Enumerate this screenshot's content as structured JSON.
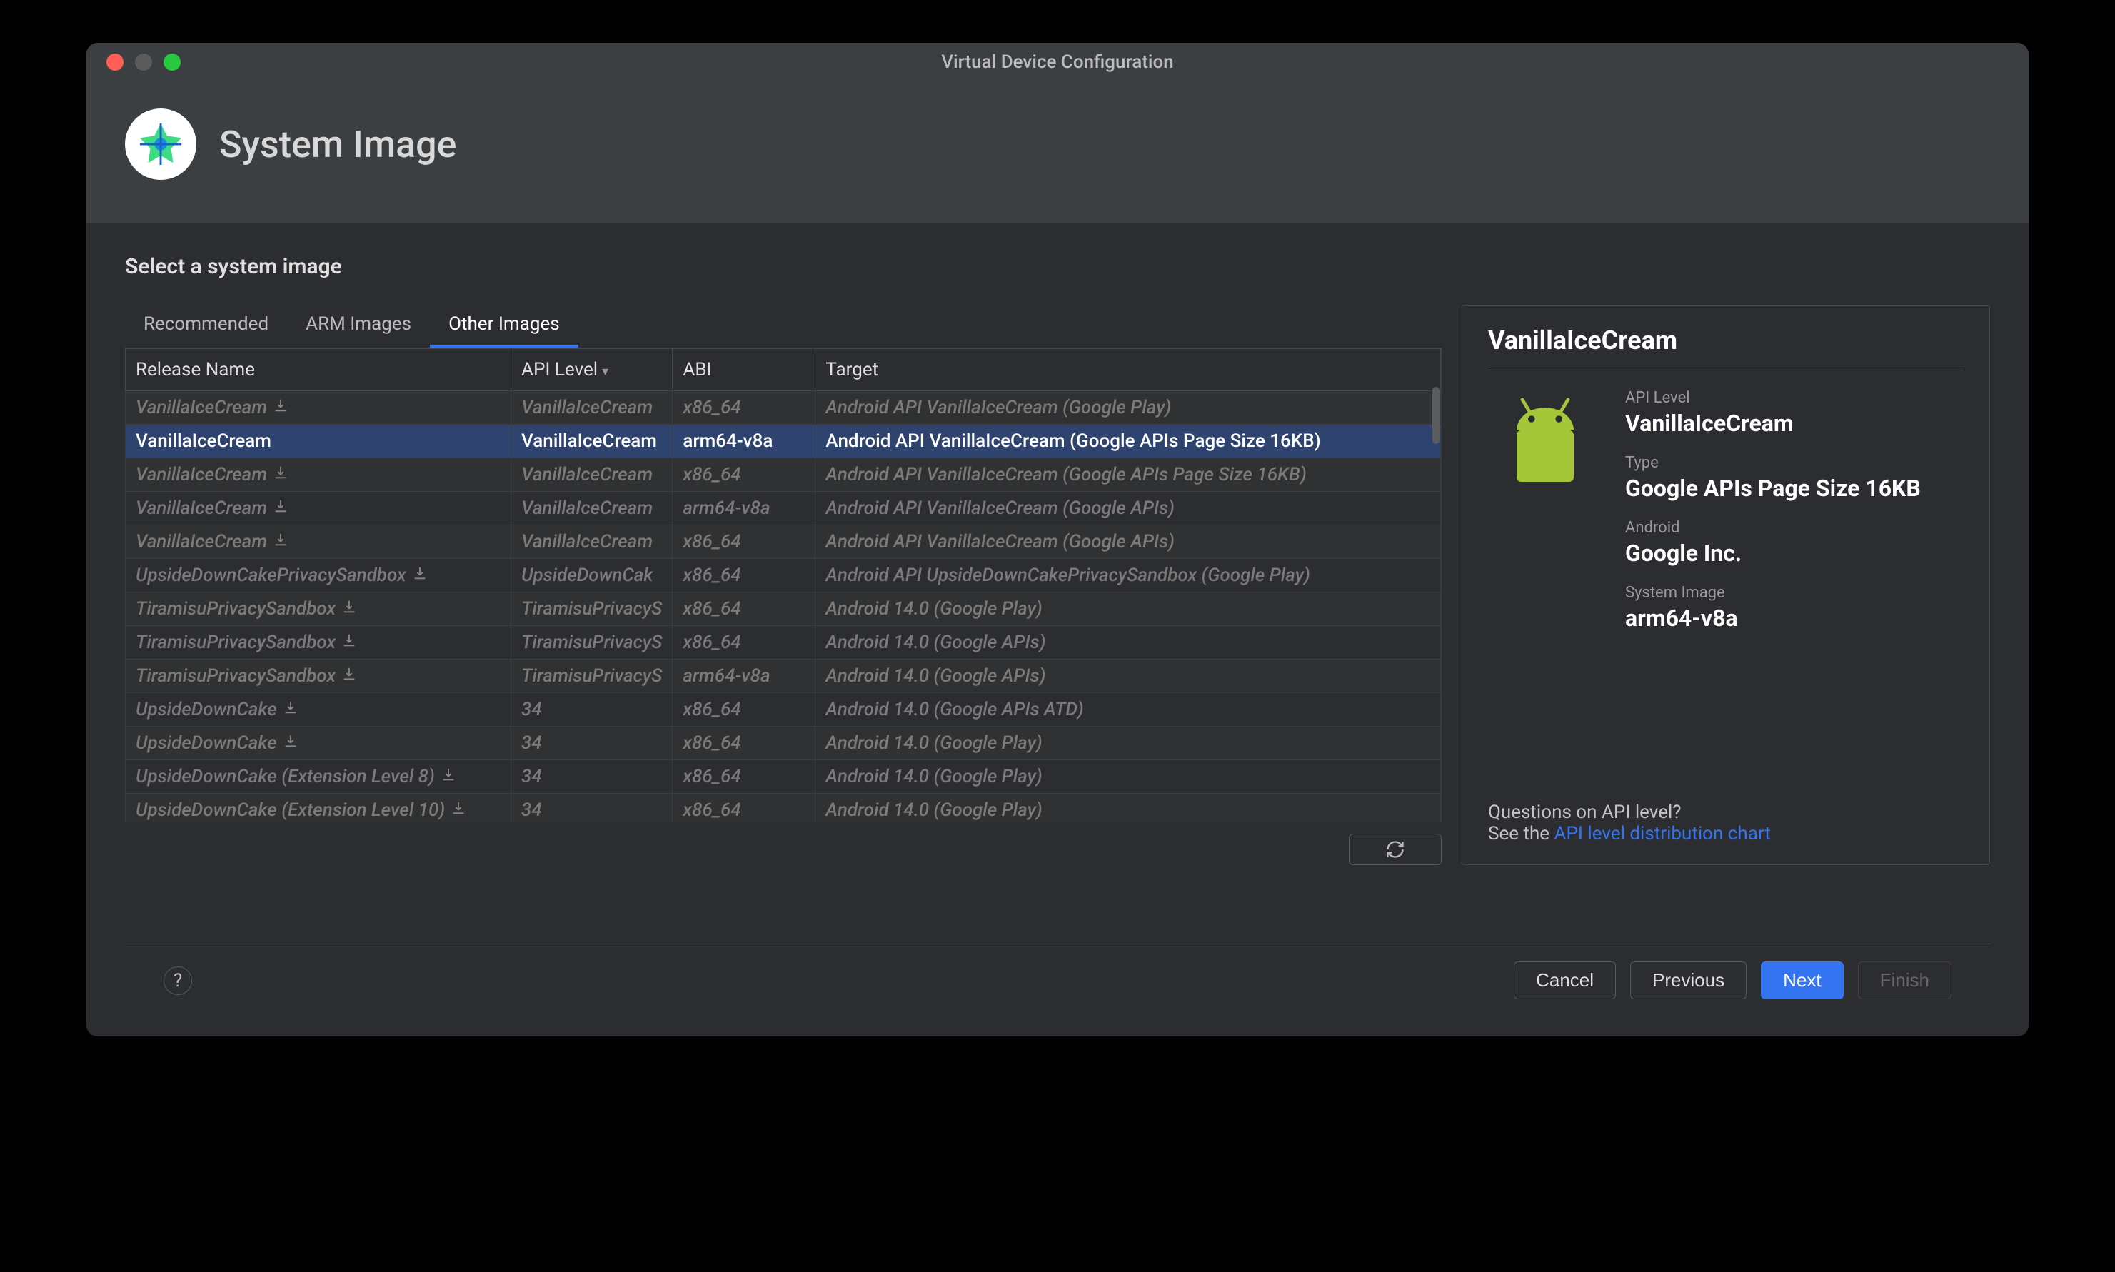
{
  "window": {
    "title": "Virtual Device Configuration"
  },
  "header": {
    "title": "System Image"
  },
  "subtitle": "Select a system image",
  "tabs": [
    {
      "label": "Recommended",
      "active": false
    },
    {
      "label": "ARM Images",
      "active": false
    },
    {
      "label": "Other Images",
      "active": true
    }
  ],
  "columns": {
    "release": "Release Name",
    "api": "API Level",
    "abi": "ABI",
    "target": "Target"
  },
  "rows": [
    {
      "release": "VanillaIceCream",
      "download": true,
      "api": "VanillaIceCream",
      "abi": "x86_64",
      "target": "Android API VanillaIceCream (Google Play)",
      "selected": false
    },
    {
      "release": "VanillaIceCream",
      "download": false,
      "api": "VanillaIceCream",
      "abi": "arm64-v8a",
      "target": "Android API VanillaIceCream (Google APIs Page Size 16KB)",
      "selected": true
    },
    {
      "release": "VanillaIceCream",
      "download": true,
      "api": "VanillaIceCream",
      "abi": "x86_64",
      "target": "Android API VanillaIceCream (Google APIs Page Size 16KB)",
      "selected": false
    },
    {
      "release": "VanillaIceCream",
      "download": true,
      "api": "VanillaIceCream",
      "abi": "arm64-v8a",
      "target": "Android API VanillaIceCream (Google APIs)",
      "selected": false
    },
    {
      "release": "VanillaIceCream",
      "download": true,
      "api": "VanillaIceCream",
      "abi": "x86_64",
      "target": "Android API VanillaIceCream (Google APIs)",
      "selected": false
    },
    {
      "release": "UpsideDownCakePrivacySandbox",
      "download": true,
      "api": "UpsideDownCak",
      "abi": "x86_64",
      "target": "Android API UpsideDownCakePrivacySandbox (Google Play)",
      "selected": false
    },
    {
      "release": "TiramisuPrivacySandbox",
      "download": true,
      "api": "TiramisuPrivacyS",
      "abi": "x86_64",
      "target": "Android 14.0 (Google Play)",
      "selected": false
    },
    {
      "release": "TiramisuPrivacySandbox",
      "download": true,
      "api": "TiramisuPrivacyS",
      "abi": "x86_64",
      "target": "Android 14.0 (Google APIs)",
      "selected": false
    },
    {
      "release": "TiramisuPrivacySandbox",
      "download": true,
      "api": "TiramisuPrivacyS",
      "abi": "arm64-v8a",
      "target": "Android 14.0 (Google APIs)",
      "selected": false
    },
    {
      "release": "UpsideDownCake",
      "download": true,
      "api": "34",
      "abi": "x86_64",
      "target": "Android 14.0 (Google APIs ATD)",
      "selected": false
    },
    {
      "release": "UpsideDownCake",
      "download": true,
      "api": "34",
      "abi": "x86_64",
      "target": "Android 14.0 (Google Play)",
      "selected": false
    },
    {
      "release": "UpsideDownCake (Extension Level 8)",
      "download": true,
      "api": "34",
      "abi": "x86_64",
      "target": "Android 14.0 (Google Play)",
      "selected": false
    },
    {
      "release": "UpsideDownCake (Extension Level 10)",
      "download": true,
      "api": "34",
      "abi": "x86_64",
      "target": "Android 14.0 (Google Play)",
      "selected": false
    }
  ],
  "detail": {
    "name": "VanillaIceCream",
    "fields": {
      "api_label": "API Level",
      "api_value": "VanillaIceCream",
      "type_label": "Type",
      "type_value": "Google APIs Page Size 16KB",
      "android_label": "Android",
      "android_value": "Google Inc.",
      "sysimg_label": "System Image",
      "sysimg_value": "arm64-v8a"
    },
    "footer": {
      "question": "Questions on API level?",
      "see": "See the ",
      "link": "API level distribution chart"
    }
  },
  "buttons": {
    "help": "?",
    "cancel": "Cancel",
    "previous": "Previous",
    "next": "Next",
    "finish": "Finish"
  }
}
